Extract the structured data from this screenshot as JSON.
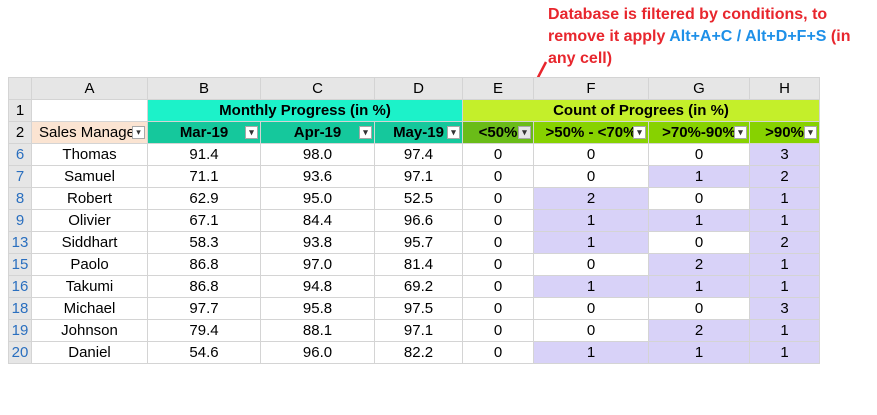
{
  "annotation": {
    "line1": "Database is filtered by conditions, to",
    "line2_prefix": "remove it apply ",
    "shortcut": "Alt+A+C / Alt+D+F+S",
    "line2_suffix": " (in",
    "line3": "any cell)",
    "text_color": "#e8262d",
    "shortcut_color": "#1e90e8"
  },
  "sheet": {
    "columns": [
      "A",
      "B",
      "C",
      "D",
      "E",
      "F",
      "G",
      "H"
    ],
    "group_headers": {
      "monthly": "Monthly Progress (in %)",
      "count": "Count of Progrees (in %)"
    },
    "field_headers": [
      "Sales Manager",
      "Mar-19",
      "Apr-19",
      "May-19",
      "<50%",
      ">50% - <70%",
      ">70%-90%",
      ">90%"
    ],
    "header_row_numbers": [
      "1",
      "2"
    ],
    "rows": [
      {
        "num": "6",
        "name": "Thomas",
        "mar": "91.4",
        "apr": "98.0",
        "may": "97.4",
        "lt50": "0",
        "r50_70": "0",
        "r70_90": "0",
        "gt90": "3"
      },
      {
        "num": "7",
        "name": "Samuel",
        "mar": "71.1",
        "apr": "93.6",
        "may": "97.1",
        "lt50": "0",
        "r50_70": "0",
        "r70_90": "1",
        "gt90": "2"
      },
      {
        "num": "8",
        "name": "Robert",
        "mar": "62.9",
        "apr": "95.0",
        "may": "52.5",
        "lt50": "0",
        "r50_70": "2",
        "r70_90": "0",
        "gt90": "1"
      },
      {
        "num": "9",
        "name": "Olivier",
        "mar": "67.1",
        "apr": "84.4",
        "may": "96.6",
        "lt50": "0",
        "r50_70": "1",
        "r70_90": "1",
        "gt90": "1"
      },
      {
        "num": "13",
        "name": "Siddhart",
        "mar": "58.3",
        "apr": "93.8",
        "may": "95.7",
        "lt50": "0",
        "r50_70": "1",
        "r70_90": "0",
        "gt90": "2"
      },
      {
        "num": "15",
        "name": "Paolo",
        "mar": "86.8",
        "apr": "97.0",
        "may": "81.4",
        "lt50": "0",
        "r50_70": "0",
        "r70_90": "2",
        "gt90": "1"
      },
      {
        "num": "16",
        "name": "Takumi",
        "mar": "86.8",
        "apr": "94.8",
        "may": "69.2",
        "lt50": "0",
        "r50_70": "1",
        "r70_90": "1",
        "gt90": "1"
      },
      {
        "num": "18",
        "name": "Michael",
        "mar": "97.7",
        "apr": "95.8",
        "may": "97.5",
        "lt50": "0",
        "r50_70": "0",
        "r70_90": "0",
        "gt90": "3"
      },
      {
        "num": "19",
        "name": "Johnson",
        "mar": "79.4",
        "apr": "88.1",
        "may": "97.1",
        "lt50": "0",
        "r50_70": "0",
        "r70_90": "2",
        "gt90": "1"
      },
      {
        "num": "20",
        "name": "Daniel",
        "mar": "54.6",
        "apr": "96.0",
        "may": "82.2",
        "lt50": "0",
        "r50_70": "1",
        "r70_90": "1",
        "gt90": "1"
      }
    ]
  }
}
